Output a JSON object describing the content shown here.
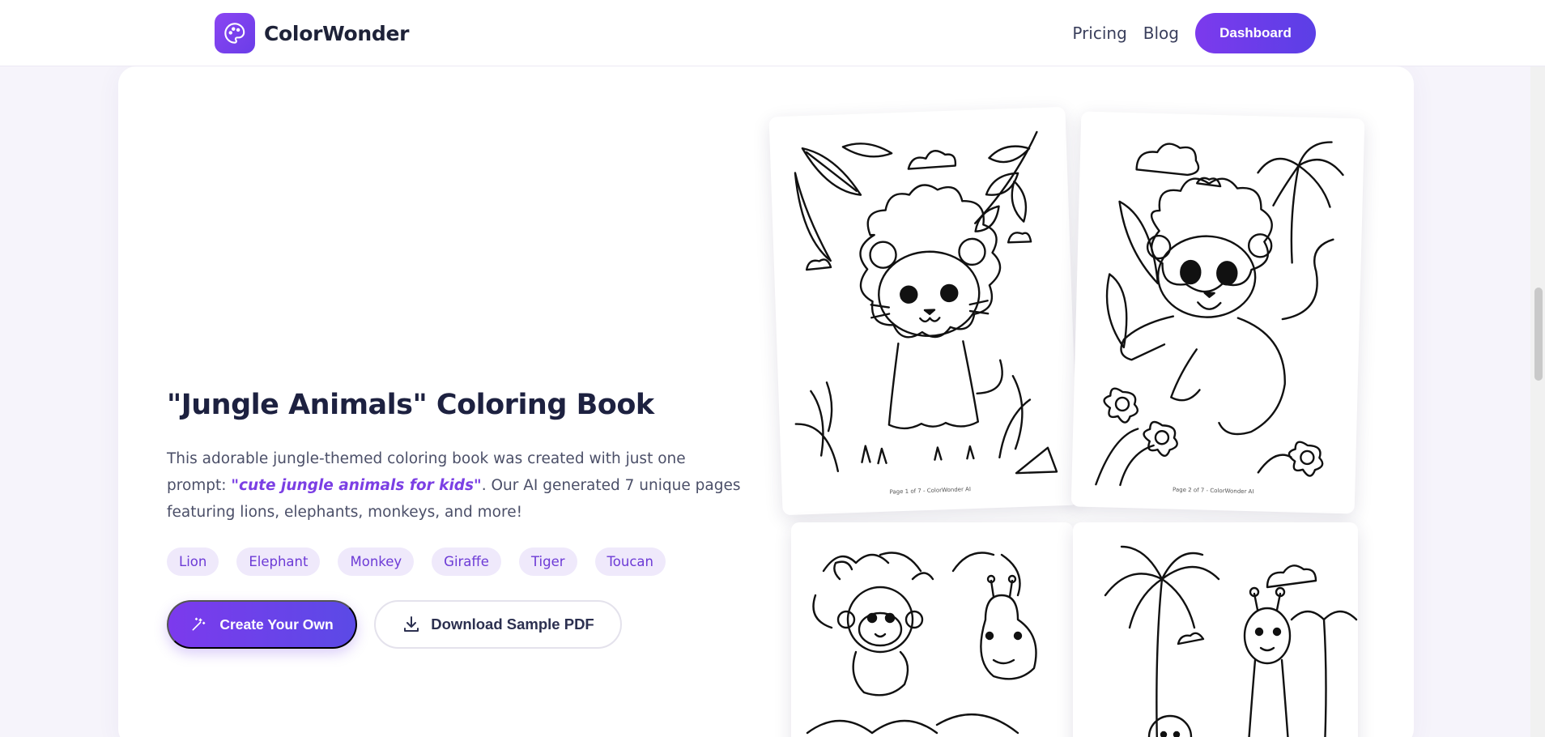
{
  "brand": {
    "name": "ColorWonder",
    "accent": "#7c3aed",
    "icon": "palette-icon"
  },
  "nav": {
    "pricing": "Pricing",
    "blog": "Blog",
    "dashboard": "Dashboard"
  },
  "hero": {
    "title": "\"Jungle Animals\" Coloring Book",
    "desc_before": "This adorable jungle-themed coloring book was created with just one prompt: ",
    "desc_prompt": "\"cute jungle animals for kids\"",
    "desc_after": ". Our AI generated 7 unique pages featuring lions, elephants, monkeys, and more!",
    "tags": [
      "Lion",
      "Elephant",
      "Monkey",
      "Giraffe",
      "Tiger",
      "Toucan"
    ],
    "create_label": "Create Your Own",
    "create_icon": "magic-wand-icon",
    "download_label": "Download Sample PDF",
    "download_icon": "download-icon"
  },
  "pages": [
    {
      "caption": "Page 1 of 7 - ColorWonder AI",
      "subject": "lion sitting"
    },
    {
      "caption": "Page 2 of 7 - ColorWonder AI",
      "subject": "lion playing"
    },
    {
      "caption": "",
      "subject": "monkey and giraffe"
    },
    {
      "caption": "",
      "subject": "giraffe and monkey with palms"
    }
  ]
}
